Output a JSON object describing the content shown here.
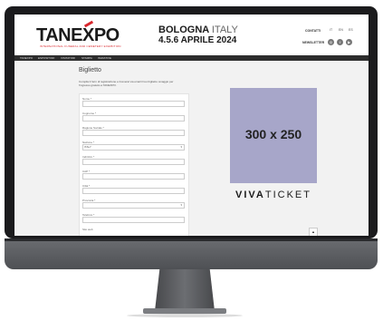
{
  "header": {
    "logo_text_left": "TANE",
    "logo_text_x": "X",
    "logo_text_right": "PO",
    "logo_subtitle": "INTERNATIONAL FUNERAL AND CEMETERY EXHIBITION",
    "city_bold": "BOLOGNA",
    "city_light": "ITALY",
    "dates": "4.5.6 APRILE 2024",
    "contacts": "CONTATTI",
    "newsletter": "NEWSLETTER",
    "languages": [
      "IT",
      "EN",
      "ES"
    ],
    "social": [
      "◎",
      "f",
      "▶"
    ]
  },
  "nav": {
    "items": [
      "TANEXPO",
      "ESPOSITORI",
      "VISITATORI",
      "STAMPA",
      "INIZIATIVE"
    ]
  },
  "form": {
    "title": "Biglietto",
    "intro": "Compila il form di registrazione e riceverai via email il tuo biglietto omaggio per l'ingresso gratuito a TANEXPO.",
    "fields": [
      {
        "label": "Nome *",
        "value": ""
      },
      {
        "label": "Cognome *",
        "value": ""
      },
      {
        "label": "Ragione Sociale *",
        "value": ""
      },
      {
        "label": "Nazione *",
        "value": "ITALY"
      },
      {
        "label": "Indirizzo *",
        "value": ""
      },
      {
        "label": "CAP *",
        "value": ""
      },
      {
        "label": "Città *",
        "value": ""
      },
      {
        "label": "Provincia *",
        "value": ""
      },
      {
        "label": "Telefono *",
        "value": ""
      },
      {
        "label": "Sito web",
        "value": ""
      }
    ]
  },
  "ad": {
    "size_text": "300 x 250"
  },
  "sponsor": {
    "bold": "VIVA",
    "light": "TICKET"
  },
  "scroll_top": "▲"
}
